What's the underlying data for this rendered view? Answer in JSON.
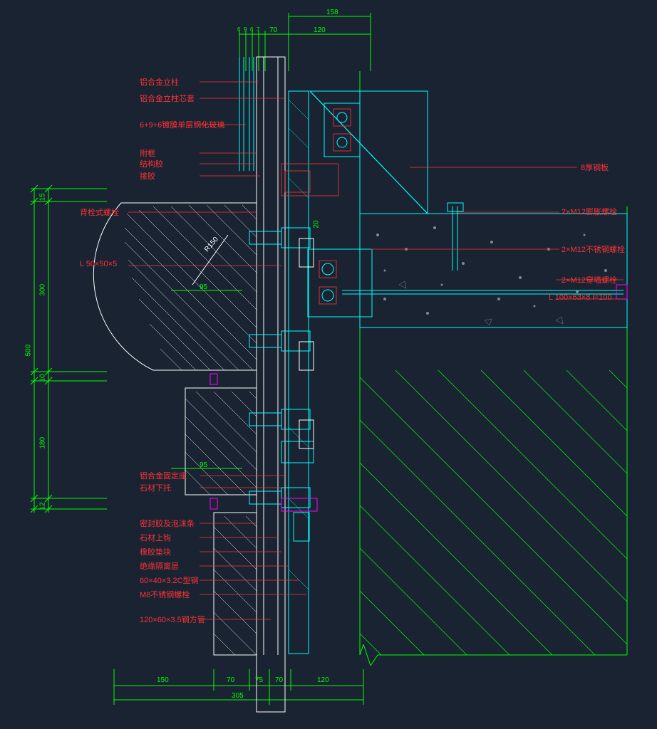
{
  "annotations": {
    "left": {
      "a1": "铝合金立柱",
      "a2": "铝合金立柱芯套",
      "a3": "6+9+6镀膜单层钢化玻璃",
      "a4": "附框",
      "a5": "结构胶",
      "a6": "接胶",
      "a7": "背栓式螺栓",
      "a8": "L 50×50×5",
      "a9": "铝合金固定座",
      "a10": "石材下托",
      "a11": "密封胶及泡沫条",
      "a12": "石材上钩",
      "a13": "橡胶垫块",
      "a14": "绝缘隔离层",
      "a15": "60×40×3.2C型钢",
      "a16": "M8不锈钢螺栓",
      "a17": "120×60×3.5钢方管"
    },
    "right": {
      "r1": "8厚钢板",
      "r2": "2×M12膨胀螺栓",
      "r3": "2×M12不锈钢螺栓",
      "r4": "2×M12穿墙螺栓",
      "r5": "L 100×63×8    l=100"
    }
  },
  "dimensions": {
    "top": {
      "d1": "158",
      "d2": "120",
      "d3a": "6",
      "d3b": "9",
      "d3c": "6",
      "d3d": "7",
      "d3e": "70"
    },
    "left": {
      "v1": "15",
      "v2": "300",
      "v3": "10",
      "v4": "180",
      "v5": "12",
      "vtotal": "500"
    },
    "bottom": {
      "b1": "150",
      "b2": "70",
      "b3": "75",
      "b4": "70",
      "b5": "120",
      "btotal": "305"
    },
    "mid": {
      "gamma1": "95",
      "gamma2": "95",
      "r": "R150",
      "t20": "20"
    }
  }
}
